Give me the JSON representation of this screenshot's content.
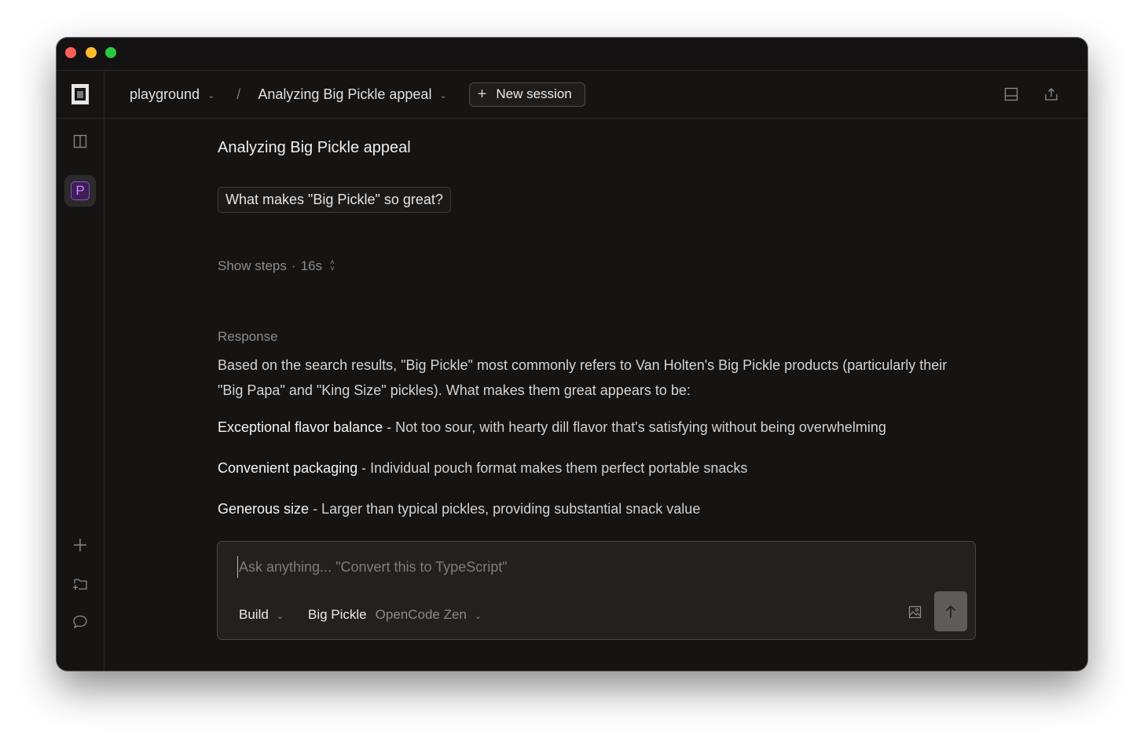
{
  "window": {
    "traffic_lights": {
      "close": "#ff5f57",
      "minimize": "#febc2e",
      "zoom": "#28c840"
    }
  },
  "sidebar": {
    "logo_icon": "opencode-logo-icon",
    "toggle_icon": "sidebar-panel-icon",
    "project_initial": "P",
    "project_color": "#c98cff",
    "bottom_icons": [
      "plus-icon",
      "folder-add-icon",
      "chat-bubble-icon"
    ]
  },
  "topbar": {
    "project": "playground",
    "separator": "/",
    "session": "Analyzing Big Pickle appeal",
    "new_session_label": "New session",
    "right_icons": [
      "layout-panel-icon",
      "share-icon"
    ]
  },
  "conversation": {
    "title": "Analyzing Big Pickle appeal",
    "user_message": "What makes \"Big Pickle\" so great?",
    "steps_label": "Show steps",
    "steps_separator": "·",
    "steps_duration": "16s",
    "response_label": "Response",
    "response_intro": "Based on the search results, \"Big Pickle\" most commonly refers to Van Holten's Big Pickle products (particularly their \"Big Papa\" and \"King Size\" pickles). What makes them great appears to be:",
    "points": [
      {
        "title": "Exceptional flavor balance",
        "text": " - Not too sour, with hearty dill flavor that's satisfying without being overwhelming"
      },
      {
        "title": "Convenient packaging",
        "text": " - Individual pouch format makes them perfect portable snacks"
      },
      {
        "title": "Generous size",
        "text": " - Larger than typical pickles, providing substantial snack value"
      }
    ]
  },
  "composer": {
    "placeholder": "Ask anything... \"Convert this to TypeScript\"",
    "value": "",
    "agent": "Build",
    "model_name": "Big Pickle",
    "model_provider": "OpenCode Zen",
    "attach_icon": "image-icon",
    "send_icon": "arrow-up-icon"
  }
}
